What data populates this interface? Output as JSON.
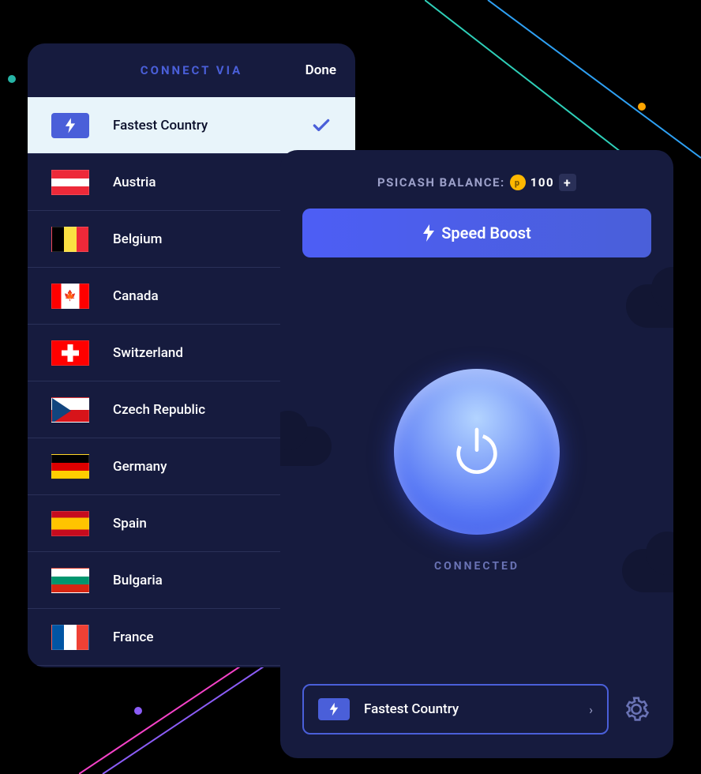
{
  "countryPanel": {
    "title": "CONNECT VIA",
    "doneLabel": "Done",
    "items": [
      {
        "id": "fastest",
        "label": "Fastest Country",
        "flagClass": "flag-fastest",
        "selected": true
      },
      {
        "id": "at",
        "label": "Austria",
        "flagClass": "flag-at",
        "selected": false
      },
      {
        "id": "be",
        "label": "Belgium",
        "flagClass": "flag-be",
        "selected": false
      },
      {
        "id": "ca",
        "label": "Canada",
        "flagClass": "flag-ca",
        "selected": false
      },
      {
        "id": "ch",
        "label": "Switzerland",
        "flagClass": "flag-ch",
        "selected": false
      },
      {
        "id": "cz",
        "label": "Czech Republic",
        "flagClass": "flag-cz",
        "selected": false
      },
      {
        "id": "de",
        "label": "Germany",
        "flagClass": "flag-de",
        "selected": false
      },
      {
        "id": "es",
        "label": "Spain",
        "flagClass": "flag-es",
        "selected": false
      },
      {
        "id": "bg",
        "label": "Bulgaria",
        "flagClass": "flag-bg",
        "selected": false
      },
      {
        "id": "fr",
        "label": "France",
        "flagClass": "flag-fr",
        "selected": false
      }
    ]
  },
  "main": {
    "psicashLabel": "PSICASH BALANCE:",
    "psicashAmount": "100",
    "psicashCoinGlyph": "p",
    "plusGlyph": "+",
    "speedBoostLabel": "Speed Boost",
    "status": "CONNECTED",
    "regionSelector": {
      "label": "Fastest Country",
      "chevron": "›"
    }
  }
}
